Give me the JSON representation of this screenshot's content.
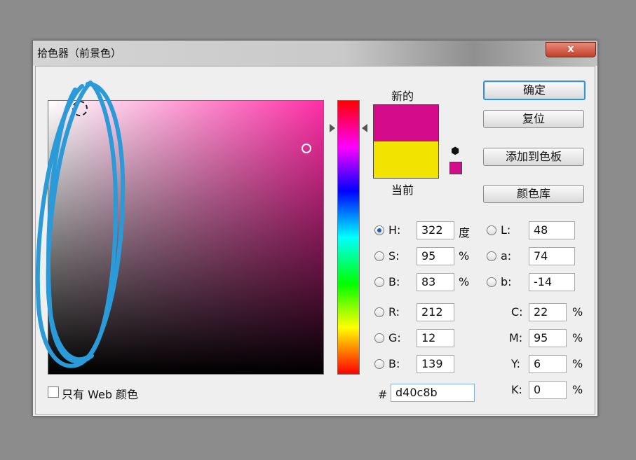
{
  "window": {
    "title": "拾色器（前景色）",
    "close_label": "x"
  },
  "preview": {
    "new_label": "新的",
    "current_label": "当前",
    "new_color": "#d40c8b",
    "current_color": "#f2e300"
  },
  "buttons": {
    "ok": "确定",
    "reset": "复位",
    "add_to_swatches": "添加到色板",
    "color_libraries": "颜色库"
  },
  "hsb": {
    "h": {
      "label": "H:",
      "value": "322",
      "unit": "度"
    },
    "s": {
      "label": "S:",
      "value": "95",
      "unit": "%"
    },
    "b": {
      "label": "B:",
      "value": "83",
      "unit": "%"
    }
  },
  "lab": {
    "l": {
      "label": "L:",
      "value": "48"
    },
    "a": {
      "label": "a:",
      "value": "74"
    },
    "b": {
      "label": "b:",
      "value": "-14"
    }
  },
  "rgb": {
    "r": {
      "label": "R:",
      "value": "212"
    },
    "g": {
      "label": "G:",
      "value": "12"
    },
    "b": {
      "label": "B:",
      "value": "139"
    }
  },
  "cmyk": {
    "c": {
      "label": "C:",
      "value": "22",
      "unit": "%"
    },
    "m": {
      "label": "M:",
      "value": "95",
      "unit": "%"
    },
    "y": {
      "label": "Y:",
      "value": "6",
      "unit": "%"
    },
    "k": {
      "label": "K:",
      "value": "0",
      "unit": "%"
    }
  },
  "hex": {
    "label": "#",
    "value": "d40c8b"
  },
  "web_only": {
    "label": "只有 Web 颜色"
  },
  "colors": {
    "annotation": "#2a9ad8",
    "accent": "#3d8fd4"
  }
}
